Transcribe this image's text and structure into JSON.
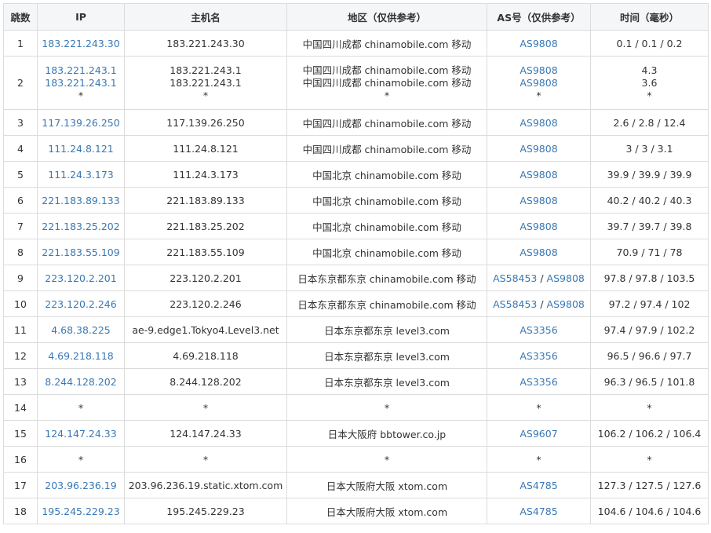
{
  "table": {
    "columns": [
      "跳数",
      "IP",
      "主机名",
      "地区（仅供参考）",
      "AS号（仅供参考）",
      "时间（毫秒）"
    ],
    "rows": [
      {
        "hop": "1",
        "ip": [
          "183.221.243.30"
        ],
        "host": [
          "183.221.243.30"
        ],
        "region": [
          "中国四川成都 chinamobile.com 移动"
        ],
        "asn": [
          [
            "AS9808"
          ]
        ],
        "time": [
          "0.1 / 0.1 / 0.2"
        ]
      },
      {
        "hop": "2",
        "ip": [
          "183.221.243.1",
          "183.221.243.1",
          "*"
        ],
        "host": [
          "183.221.243.1",
          "183.221.243.1",
          "*"
        ],
        "region": [
          "中国四川成都 chinamobile.com 移动",
          "中国四川成都 chinamobile.com 移动",
          "*"
        ],
        "asn": [
          [
            "AS9808"
          ],
          [
            "AS9808"
          ],
          [
            "*"
          ]
        ],
        "time": [
          "4.3",
          "3.6",
          "*"
        ]
      },
      {
        "hop": "3",
        "ip": [
          "117.139.26.250"
        ],
        "host": [
          "117.139.26.250"
        ],
        "region": [
          "中国四川成都 chinamobile.com 移动"
        ],
        "asn": [
          [
            "AS9808"
          ]
        ],
        "time": [
          "2.6 / 2.8 / 12.4"
        ]
      },
      {
        "hop": "4",
        "ip": [
          "111.24.8.121"
        ],
        "host": [
          "111.24.8.121"
        ],
        "region": [
          "中国四川成都 chinamobile.com 移动"
        ],
        "asn": [
          [
            "AS9808"
          ]
        ],
        "time": [
          "3 / 3 / 3.1"
        ]
      },
      {
        "hop": "5",
        "ip": [
          "111.24.3.173"
        ],
        "host": [
          "111.24.3.173"
        ],
        "region": [
          "中国北京 chinamobile.com 移动"
        ],
        "asn": [
          [
            "AS9808"
          ]
        ],
        "time": [
          "39.9 / 39.9 / 39.9"
        ]
      },
      {
        "hop": "6",
        "ip": [
          "221.183.89.133"
        ],
        "host": [
          "221.183.89.133"
        ],
        "region": [
          "中国北京 chinamobile.com 移动"
        ],
        "asn": [
          [
            "AS9808"
          ]
        ],
        "time": [
          "40.2 / 40.2 / 40.3"
        ]
      },
      {
        "hop": "7",
        "ip": [
          "221.183.25.202"
        ],
        "host": [
          "221.183.25.202"
        ],
        "region": [
          "中国北京 chinamobile.com 移动"
        ],
        "asn": [
          [
            "AS9808"
          ]
        ],
        "time": [
          "39.7 / 39.7 / 39.8"
        ]
      },
      {
        "hop": "8",
        "ip": [
          "221.183.55.109"
        ],
        "host": [
          "221.183.55.109"
        ],
        "region": [
          "中国北京 chinamobile.com 移动"
        ],
        "asn": [
          [
            "AS9808"
          ]
        ],
        "time": [
          "70.9 / 71 / 78"
        ]
      },
      {
        "hop": "9",
        "ip": [
          "223.120.2.201"
        ],
        "host": [
          "223.120.2.201"
        ],
        "region": [
          "日本东京都东京 chinamobile.com 移动"
        ],
        "asn": [
          [
            "AS58453",
            "AS9808"
          ]
        ],
        "time": [
          "97.8 / 97.8 / 103.5"
        ]
      },
      {
        "hop": "10",
        "ip": [
          "223.120.2.246"
        ],
        "host": [
          "223.120.2.246"
        ],
        "region": [
          "日本东京都东京 chinamobile.com 移动"
        ],
        "asn": [
          [
            "AS58453",
            "AS9808"
          ]
        ],
        "time": [
          "97.2 / 97.4 / 102"
        ]
      },
      {
        "hop": "11",
        "ip": [
          "4.68.38.225"
        ],
        "host": [
          "ae-9.edge1.Tokyo4.Level3.net"
        ],
        "region": [
          "日本东京都东京 level3.com"
        ],
        "asn": [
          [
            "AS3356"
          ]
        ],
        "time": [
          "97.4 / 97.9 / 102.2"
        ]
      },
      {
        "hop": "12",
        "ip": [
          "4.69.218.118"
        ],
        "host": [
          "4.69.218.118"
        ],
        "region": [
          "日本东京都东京 level3.com"
        ],
        "asn": [
          [
            "AS3356"
          ]
        ],
        "time": [
          "96.5 / 96.6 / 97.7"
        ]
      },
      {
        "hop": "13",
        "ip": [
          "8.244.128.202"
        ],
        "host": [
          "8.244.128.202"
        ],
        "region": [
          "日本东京都东京 level3.com"
        ],
        "asn": [
          [
            "AS3356"
          ]
        ],
        "time": [
          "96.3 / 96.5 / 101.8"
        ]
      },
      {
        "hop": "14",
        "ip": [
          "*"
        ],
        "host": [
          "*"
        ],
        "region": [
          "*"
        ],
        "asn": [
          [
            "*"
          ]
        ],
        "time": [
          "*"
        ]
      },
      {
        "hop": "15",
        "ip": [
          "124.147.24.33"
        ],
        "host": [
          "124.147.24.33"
        ],
        "region": [
          "日本大阪府 bbtower.co.jp"
        ],
        "asn": [
          [
            "AS9607"
          ]
        ],
        "time": [
          "106.2 / 106.2 / 106.4"
        ]
      },
      {
        "hop": "16",
        "ip": [
          "*"
        ],
        "host": [
          "*"
        ],
        "region": [
          "*"
        ],
        "asn": [
          [
            "*"
          ]
        ],
        "time": [
          "*"
        ]
      },
      {
        "hop": "17",
        "ip": [
          "203.96.236.19"
        ],
        "host": [
          "203.96.236.19.static.xtom.com"
        ],
        "region": [
          "日本大阪府大阪 xtom.com"
        ],
        "asn": [
          [
            "AS4785"
          ]
        ],
        "time": [
          "127.3 / 127.5 / 127.6"
        ]
      },
      {
        "hop": "18",
        "ip": [
          "195.245.229.23"
        ],
        "host": [
          "195.245.229.23"
        ],
        "region": [
          "日本大阪府大阪 xtom.com"
        ],
        "asn": [
          [
            "AS4785"
          ]
        ],
        "time": [
          "104.6 / 104.6 / 104.6"
        ]
      }
    ]
  },
  "colors": {
    "link": "#3a78b5",
    "text": "#333333",
    "header_bg": "#f5f6f7",
    "border": "#dcdcdc"
  }
}
